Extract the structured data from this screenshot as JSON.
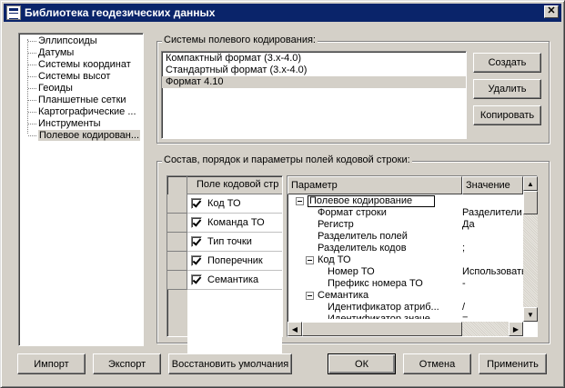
{
  "window": {
    "title": "Библиотека геодезических данных",
    "close_glyph": "✕"
  },
  "sidebar": {
    "items": [
      {
        "label": "Эллипсоиды"
      },
      {
        "label": "Датумы"
      },
      {
        "label": "Системы координат"
      },
      {
        "label": "Системы высот"
      },
      {
        "label": "Геоиды"
      },
      {
        "label": "Планшетные сетки"
      },
      {
        "label": "Картографические ..."
      },
      {
        "label": "Инструменты"
      },
      {
        "label": "Полевое кодирован..."
      }
    ],
    "selected_index": 8
  },
  "coding_systems": {
    "title": "Системы полевого кодирования:",
    "items": [
      {
        "label": "Компактный формат (3.x-4.0)"
      },
      {
        "label": "Стандартный формат (3.x-4.0)"
      },
      {
        "label": "Формат 4.10"
      }
    ],
    "selected_index": 2,
    "create_label": "Создать",
    "delete_label": "Удалить",
    "copy_label": "Копировать"
  },
  "composition": {
    "title": "Состав, порядок и параметры полей кодовой строки:",
    "fields_header": "Поле кодовой стр",
    "fields": [
      {
        "label": "Код ТО",
        "checked": true
      },
      {
        "label": "Команда ТО",
        "checked": true
      },
      {
        "label": "Тип точки",
        "checked": true
      },
      {
        "label": "Поперечник",
        "checked": true
      },
      {
        "label": "Семантика",
        "checked": true
      }
    ],
    "params_header": {
      "name": "Параметр",
      "value": "Значение"
    },
    "params": [
      {
        "name": "Полевое кодирование",
        "value": "",
        "level": 0,
        "expander": true
      },
      {
        "name": "Формат строки",
        "value": "Разделители",
        "level": 1,
        "expander": false
      },
      {
        "name": "Регистр",
        "value": "Да",
        "level": 1,
        "expander": false
      },
      {
        "name": "Разделитель полей",
        "value": "",
        "level": 1,
        "expander": false
      },
      {
        "name": "Разделитель кодов",
        "value": ";",
        "level": 1,
        "expander": false
      },
      {
        "name": "Код ТО",
        "value": "",
        "level": 1,
        "expander": true
      },
      {
        "name": "Номер ТО",
        "value": "Использовать",
        "level": 2,
        "expander": false
      },
      {
        "name": "Префикс номера ТО",
        "value": "-",
        "level": 2,
        "expander": false
      },
      {
        "name": "Семантика",
        "value": "",
        "level": 1,
        "expander": true
      },
      {
        "name": "Идентификатор атриб...",
        "value": "/",
        "level": 2,
        "expander": false
      },
      {
        "name": "Идентификатор значе...",
        "value": "=",
        "level": 2,
        "expander": false
      }
    ]
  },
  "footer": {
    "import_label": "Импорт",
    "export_label": "Экспорт",
    "restore_label": "Восстановить умолчания",
    "ok_label": "ОК",
    "cancel_label": "Отмена",
    "apply_label": "Применить"
  },
  "colors": {
    "titlebar": "#0a246a",
    "face": "#d4d0c8",
    "window": "#ffffff"
  }
}
